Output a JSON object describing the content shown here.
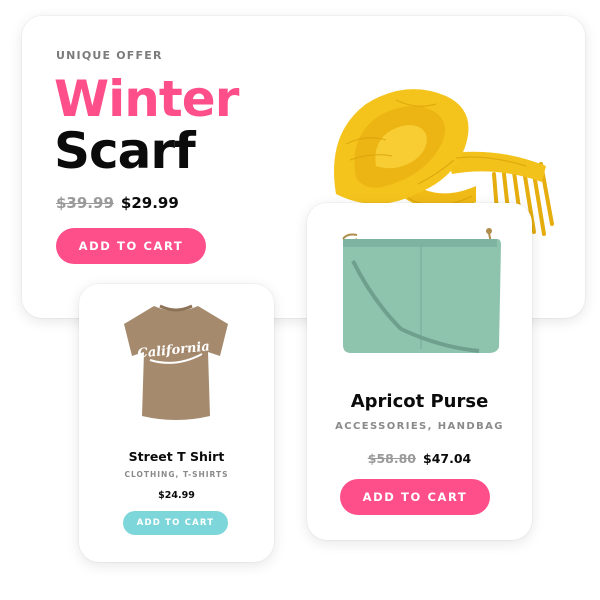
{
  "hero": {
    "eyebrow": "UNIQUE OFFER",
    "title_line1": "Winter",
    "title_line2": "Scarf",
    "old_price": "$39.99",
    "price": "$29.99",
    "cta": "ADD TO CART",
    "image": "yellow-knit-scarf"
  },
  "purse": {
    "name": "Apricot Purse",
    "categories": "ACCESSORIES, HANDBAG",
    "old_price": "$58.80",
    "price": "$47.04",
    "cta": "ADD TO CART",
    "image": "mint-green-purse"
  },
  "tee": {
    "name": "Street T Shirt",
    "categories": "CLOTHING, T-SHIRTS",
    "price": "$24.99",
    "cta": "ADD TO CART",
    "image": "brown-california-t-shirt"
  },
  "colors": {
    "accent_pink": "#fe4f8a",
    "accent_teal": "#7dd6d9",
    "text_dark": "#0b0b0b",
    "text_muted": "#8a8a8a",
    "scarf_yellow": "#f3c21a",
    "purse_green": "#8ec3ae",
    "tee_brown": "#a68a6e"
  }
}
